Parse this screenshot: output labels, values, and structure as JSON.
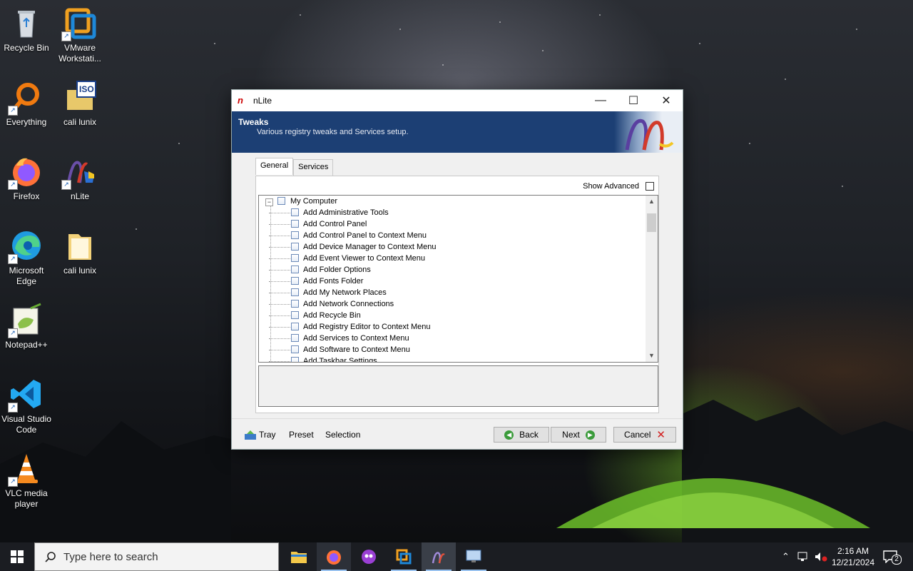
{
  "desktop": {
    "icons": [
      {
        "label": "Recycle Bin"
      },
      {
        "label": "VMware Workstati..."
      },
      {
        "label": "Everything"
      },
      {
        "label": "cali lunix"
      },
      {
        "label": "Firefox"
      },
      {
        "label": "nLite"
      },
      {
        "label": "Microsoft Edge"
      },
      {
        "label": "cali lunix"
      },
      {
        "label": "Notepad++"
      },
      {
        "label": "Visual Studio Code"
      },
      {
        "label": "VLC media player"
      }
    ],
    "iso_badge": "ISO"
  },
  "window": {
    "title": "nLite",
    "banner": {
      "heading": "Tweaks",
      "subtitle": "Various registry tweaks and Services setup."
    },
    "tabs": [
      {
        "label": "General",
        "active": true
      },
      {
        "label": "Services",
        "active": false
      }
    ],
    "show_advanced_label": "Show Advanced",
    "tree": {
      "root": "My Computer",
      "items": [
        "Add Administrative Tools",
        "Add Control Panel",
        "Add Control Panel to Context Menu",
        "Add Device Manager to Context Menu",
        "Add Event Viewer to Context Menu",
        "Add Folder Options",
        "Add Fonts Folder",
        "Add My Network Places",
        "Add Network Connections",
        "Add Recycle Bin",
        "Add Registry Editor to Context Menu",
        "Add Services to Context Menu",
        "Add Software to Context Menu",
        "Add Taskbar Settings"
      ]
    },
    "footer": {
      "tray": "Tray",
      "preset": "Preset",
      "selection": "Selection",
      "back": "Back",
      "next": "Next",
      "cancel": "Cancel"
    }
  },
  "taskbar": {
    "search_placeholder": "Type here to search",
    "apps": [
      "file-explorer",
      "firefox",
      "media-app",
      "vmware",
      "nlite",
      "remote-desktop"
    ],
    "time": "2:16 AM",
    "date": "12/21/2024",
    "notification_count": "2"
  },
  "colors": {
    "banner": "#1c3f74",
    "taskbar": "#1b1d22",
    "accent_green": "#3a9b3a",
    "cancel_red": "#d21f1f"
  }
}
